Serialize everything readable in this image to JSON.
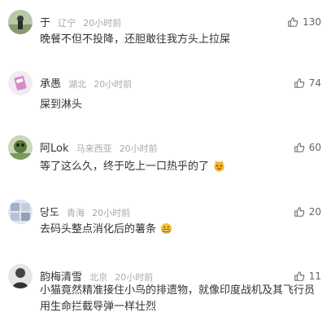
{
  "comments": [
    {
      "username": "于",
      "location": "辽宁",
      "time": "20小时前",
      "likes": "130",
      "text": "晚餐不但不投降，还胆敢往我方头上拉屎",
      "avatar_icon": "photo-avatar-outdoor"
    },
    {
      "username": "承愚",
      "location": "湖北",
      "time": "20小时前",
      "likes": "74",
      "text": "屎到淋头",
      "avatar_icon": "photo-avatar-pink"
    },
    {
      "username": "阿Lok",
      "location": "马来西亚",
      "time": "20小时前",
      "likes": "60",
      "text": "等了这么久，终于吃上一口热乎的了",
      "emoji": "cat-face-emoji",
      "avatar_icon": "photo-avatar-green"
    },
    {
      "username": "당도",
      "location": "青海",
      "time": "20小时前",
      "likes": "20",
      "text": "去码头整点消化后的薯条",
      "emoji": "grin-face-emoji",
      "avatar_icon": "photo-avatar-anime"
    },
    {
      "username": "韵梅清雪",
      "location": "北京",
      "time": "20小时前",
      "likes": "11",
      "text": "小猫竟然精准接住小鸟的排遗物，就像印度战机及其飞行员用生命拦截导弹一样壮烈",
      "avatar_icon": "photo-avatar-dark"
    }
  ],
  "colors": {
    "text": "#333333",
    "meta": "#a8a8a8",
    "like": "#666666"
  }
}
